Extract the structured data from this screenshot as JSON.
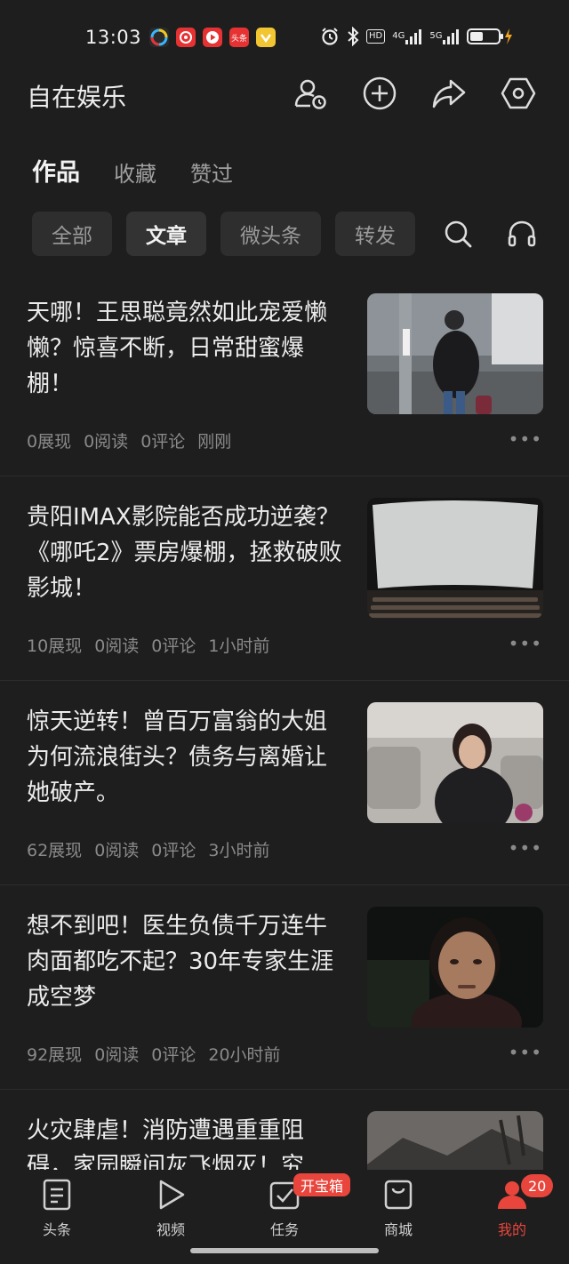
{
  "colors": {
    "background": "#1e1e1e",
    "accent": "#e8453c",
    "muted": "#8a8a8a"
  },
  "status_bar": {
    "time": "13:03",
    "apps": [
      {
        "icon": "pinwheel-app-icon",
        "color": "#2a2a2a",
        "label": ""
      },
      {
        "icon": "music-app-icon",
        "color": "#e63232",
        "label": ""
      },
      {
        "icon": "video-app-icon",
        "color": "#e63232",
        "label": ""
      },
      {
        "icon": "toutiao-app-icon",
        "color": "#e63232",
        "label": "头条"
      },
      {
        "icon": "vip-app-icon",
        "color": "#f2c533",
        "label": ""
      }
    ],
    "hd_label": "HD",
    "net_4g": "4G",
    "net_5g": "5G"
  },
  "header": {
    "title": "自在娱乐",
    "icons": [
      "user-settings-icon",
      "add-circle-icon",
      "share-icon",
      "settings-hexagon-icon"
    ]
  },
  "tabs": [
    {
      "label": "作品",
      "active": true
    },
    {
      "label": "收藏",
      "active": false
    },
    {
      "label": "赞过",
      "active": false
    }
  ],
  "chips": [
    {
      "label": "全部",
      "active": false
    },
    {
      "label": "文章",
      "active": true
    },
    {
      "label": "微头条",
      "active": false
    },
    {
      "label": "转发",
      "active": false
    }
  ],
  "articles": [
    {
      "title": "天哪！王思聪竟然如此宠爱懒懒？惊喜不断，日常甜蜜爆棚！",
      "impressions": "0展现",
      "reads": "0阅读",
      "comments": "0评论",
      "time": "刚刚"
    },
    {
      "title": "贵阳IMAX影院能否成功逆袭？《哪吒2》票房爆棚，拯救破败影城！",
      "impressions": "10展现",
      "reads": "0阅读",
      "comments": "0评论",
      "time": "1小时前"
    },
    {
      "title": "惊天逆转！曾百万富翁的大姐为何流浪街头？债务与离婚让她破产。",
      "impressions": "62展现",
      "reads": "0阅读",
      "comments": "0评论",
      "time": "3小时前"
    },
    {
      "title": "想不到吧！医生负债千万连牛肉面都吃不起？30年专家生涯成空梦",
      "impressions": "92展现",
      "reads": "0阅读",
      "comments": "0评论",
      "time": "20小时前"
    },
    {
      "title": "火灾肆虐！消防遭遇重重阻碍，家园瞬间灰飞烟灭！究",
      "impressions": "",
      "reads": "",
      "comments": "",
      "time": ""
    }
  ],
  "more_label": "•••",
  "bottom_nav": [
    {
      "label": "头条",
      "icon": "article-icon",
      "active": false
    },
    {
      "label": "视频",
      "icon": "play-icon",
      "active": false
    },
    {
      "label": "任务",
      "icon": "task-check-icon",
      "active": false
    },
    {
      "label": "商城",
      "icon": "shopping-bag-icon",
      "active": false
    },
    {
      "label": "我的",
      "icon": "profile-icon",
      "active": true
    }
  ],
  "task_badge": "开宝箱",
  "profile_badge": "20"
}
